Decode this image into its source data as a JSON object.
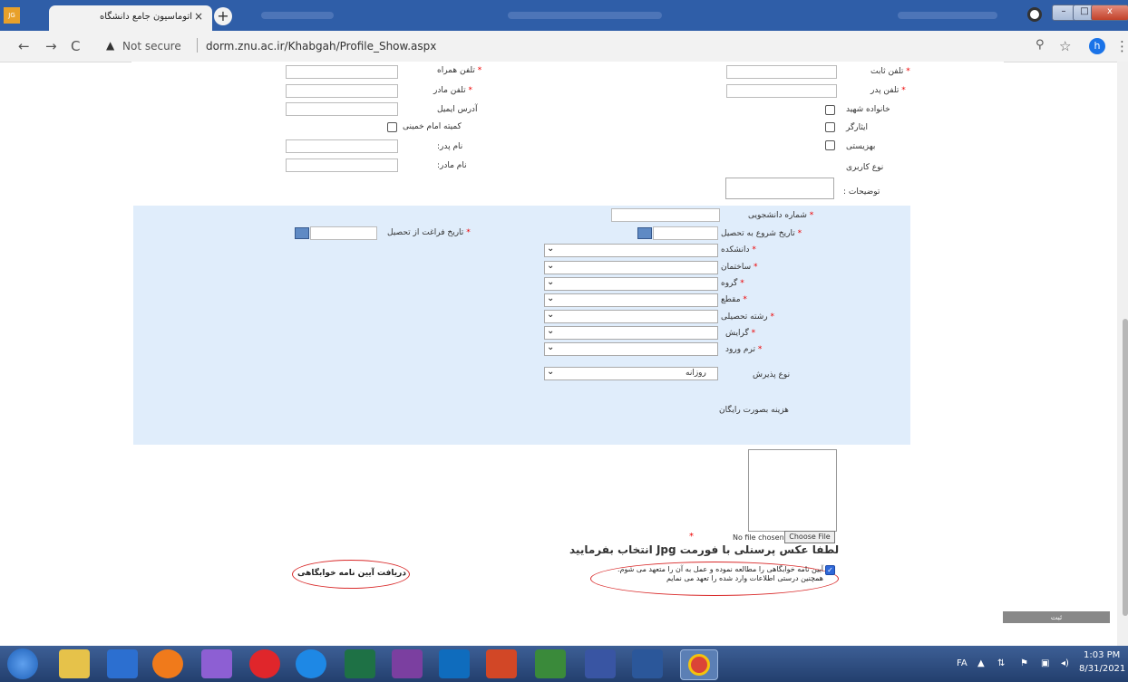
{
  "browser": {
    "tab_title": "اتوماسیون جامع دانشگاه",
    "tab_close": "×",
    "new_tab": "+",
    "not_secure": "Not secure",
    "url": "dorm.znu.ac.ir/Khabgah/Profile_Show.aspx",
    "profile_initial": "h",
    "nav_back": "←",
    "nav_forward": "→",
    "nav_reload": "C",
    "zoom_icon": "⚲",
    "star_icon": "☆",
    "menu_icon": "⋮",
    "win_min": "–",
    "win_max": "□",
    "win_close": "x",
    "favicon_text": "JG"
  },
  "form_top": {
    "mobile_label": "تلفن همراه",
    "mother_phone_label": "تلفن مادر",
    "email_label": "آدرس ایمیل",
    "khomeini_label": "کمیته امام خمینی",
    "father_name_label": "نام پدر:",
    "mother_name_label": "نام مادر:",
    "landline_label": "تلفن ثابت",
    "father_phone_label": "تلفن پدر",
    "martyr_family_label": "خانواده شهید",
    "veteran_label": "ایثارگر",
    "welfare_label": "بهزیستی",
    "user_type_label": "نوع کاربری",
    "description_label": "توضیحات :"
  },
  "form_edu": {
    "student_number_label": "شماره دانشجویی",
    "start_date_label": "تاریخ شروع به تحصیل",
    "grad_date_label": "تاریخ فراغت از تحصیل",
    "faculty_label": "دانشکده",
    "building_label": "ساختمان",
    "group_label": "گروه",
    "level_label": "مقطع",
    "major_label": "رشته تحصیلی",
    "orientation_label": "گرایش",
    "entry_term_label": "ترم ورود",
    "admission_type_label": "نوع پذیرش",
    "admission_type_value": "روزانه",
    "free_cost_label": "هزینه بصورت رایگان",
    "required_mark": "*"
  },
  "upload": {
    "no_file": "No file chosen",
    "choose_file": "Choose File",
    "instruction": "لطفا عکس پرسنلی با  فورمت Jpg انتخاب بفرمایید",
    "rules_link": "دریافت آیین نامه خوابگاهی",
    "agreement_line1": "آیین نامه خوابگاهی را مطالعه نموده و عمل به آن را متعهد می شوم.",
    "agreement_line2": "همچنین درستی اطلاعات وارد شده را تعهد می نمایم",
    "submit_label": "ثبت"
  },
  "taskbar": {
    "lang": "FA",
    "time": "1:03 PM",
    "date": "8/31/2021",
    "colors": {
      "start": "#2c6fd0",
      "ie": "#1e88e5",
      "excel": "#1e7145",
      "onenote": "#7b3fa0",
      "outlook": "#0f6cbd",
      "ppt": "#d24726",
      "project": "#3a8a3a",
      "visio": "#3955a3",
      "word": "#2b579a",
      "chrome": "#db4437"
    }
  }
}
